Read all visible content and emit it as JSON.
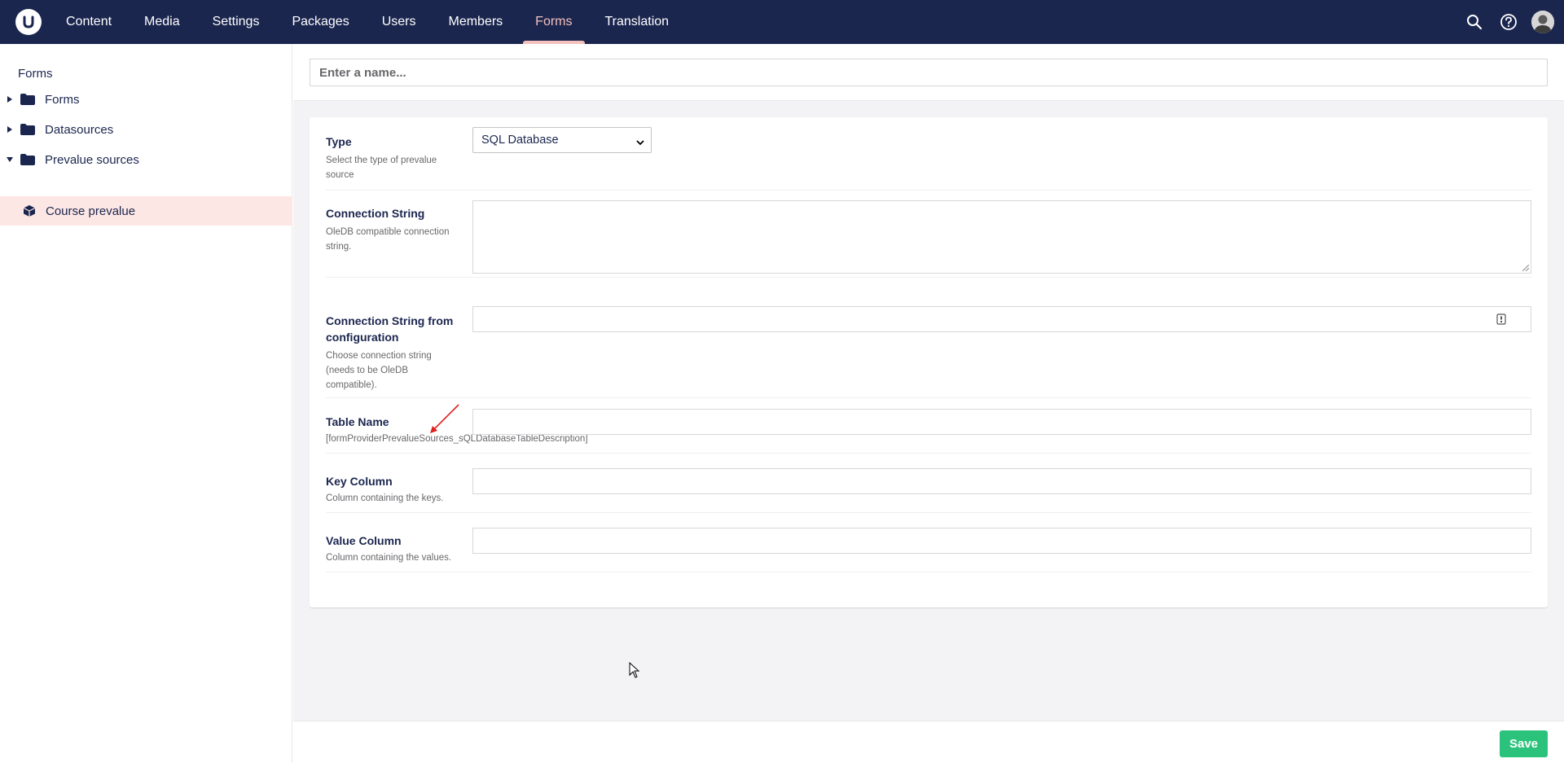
{
  "header": {
    "nav": [
      {
        "label": "Content"
      },
      {
        "label": "Media"
      },
      {
        "label": "Settings"
      },
      {
        "label": "Packages"
      },
      {
        "label": "Users"
      },
      {
        "label": "Members"
      },
      {
        "label": "Forms",
        "active": true
      },
      {
        "label": "Translation"
      }
    ],
    "icons": [
      "search-icon",
      "help-icon",
      "user-avatar"
    ]
  },
  "sidebar": {
    "title": "Forms",
    "items": [
      {
        "label": "Forms",
        "icon": "folder-icon",
        "expanded": false
      },
      {
        "label": "Datasources",
        "icon": "folder-icon",
        "expanded": false
      },
      {
        "label": "Prevalue sources",
        "icon": "folder-icon",
        "expanded": true
      },
      {
        "label": "Course prevalue",
        "icon": "cube-icon",
        "selected": true
      }
    ]
  },
  "editor": {
    "name_placeholder": "Enter a name...",
    "name_value": "",
    "properties": [
      {
        "label": "Type",
        "description": "Select the type of prevalue source",
        "selected": "SQL Database"
      },
      {
        "label": "Connection String",
        "description": "OleDB compatible connection string.",
        "value": ""
      },
      {
        "label": "Connection String from configuration",
        "description": "Choose connection string (needs to be OleDB compatible).",
        "value": ""
      },
      {
        "label": "Table Name",
        "description": "[formProviderPrevalueSources_sQLDatabaseTableDescription]",
        "value": ""
      },
      {
        "label": "Key Column",
        "description": "Column containing the keys.",
        "value": ""
      },
      {
        "label": "Value Column",
        "description": "Column containing the values.",
        "value": ""
      }
    ]
  },
  "footer": {
    "save_label": "Save"
  },
  "colors": {
    "topbar": "#1b264f",
    "active_nav": "#f5c1bc",
    "selected_item": "#fde7e4",
    "save_button": "#2bc37c",
    "annotation_arrow": "#e02020"
  }
}
